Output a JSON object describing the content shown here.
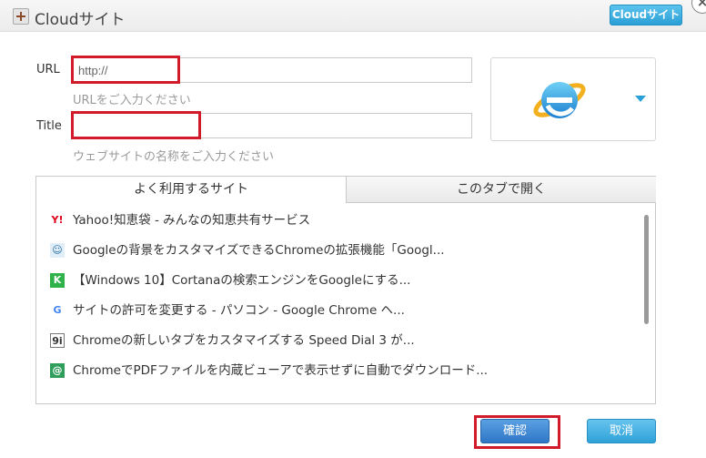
{
  "window": {
    "title": "Cloudサイト",
    "header_button": "Cloudサイト",
    "close_glyph": "×"
  },
  "form": {
    "url_label": "URL",
    "url_value": "http://",
    "url_hint": "URLをご入力ください",
    "title_label": "Title",
    "title_value": "",
    "title_hint": "ウェブサイトの名称をご入力ください",
    "icon": "internet-explorer-icon"
  },
  "tabs": [
    {
      "label": "よく利用するサイト",
      "active": true
    },
    {
      "label": "このタブで開く",
      "active": false
    }
  ],
  "sites": [
    {
      "title": "Yahoo!知恵袋 - みんなの知恵共有サービス",
      "favicon": "Y!",
      "favicon_name": "yahoo-icon",
      "color": "#e0001a",
      "bg": "#ffffff"
    },
    {
      "title": "Googleの背景をカスタマイズできるChromeの拡張機能「Googl...",
      "favicon": "☺",
      "favicon_name": "avatar-icon",
      "color": "#2b6d9e",
      "bg": "#dfeef8"
    },
    {
      "title": "【Windows 10】Cortanaの検索エンジンをGoogleにする...",
      "favicon": "K",
      "favicon_name": "k-icon",
      "color": "#ffffff",
      "bg": "#2fb24a"
    },
    {
      "title": "サイトの許可を変更する - パソコン - Google Chrome ヘ...",
      "favicon": "G",
      "favicon_name": "google-icon",
      "color": "#4285f4",
      "bg": "#ffffff"
    },
    {
      "title": "Chromeの新しいタブをカスタマイズする Speed Dial 3 が...",
      "favicon": "9i",
      "favicon_name": "9i-icon",
      "color": "#333333",
      "bg": "#ffffff"
    },
    {
      "title": "ChromeでPDFファイルを内蔵ビューアで表示せずに自動でダウンロード...",
      "favicon": "@",
      "favicon_name": "at-icon",
      "color": "#ffffff",
      "bg": "#2e9e5a"
    }
  ],
  "buttons": {
    "confirm": "確認",
    "cancel": "取消"
  },
  "colors": {
    "accent": "#2b9fd8",
    "highlight": "#d11a2a"
  }
}
